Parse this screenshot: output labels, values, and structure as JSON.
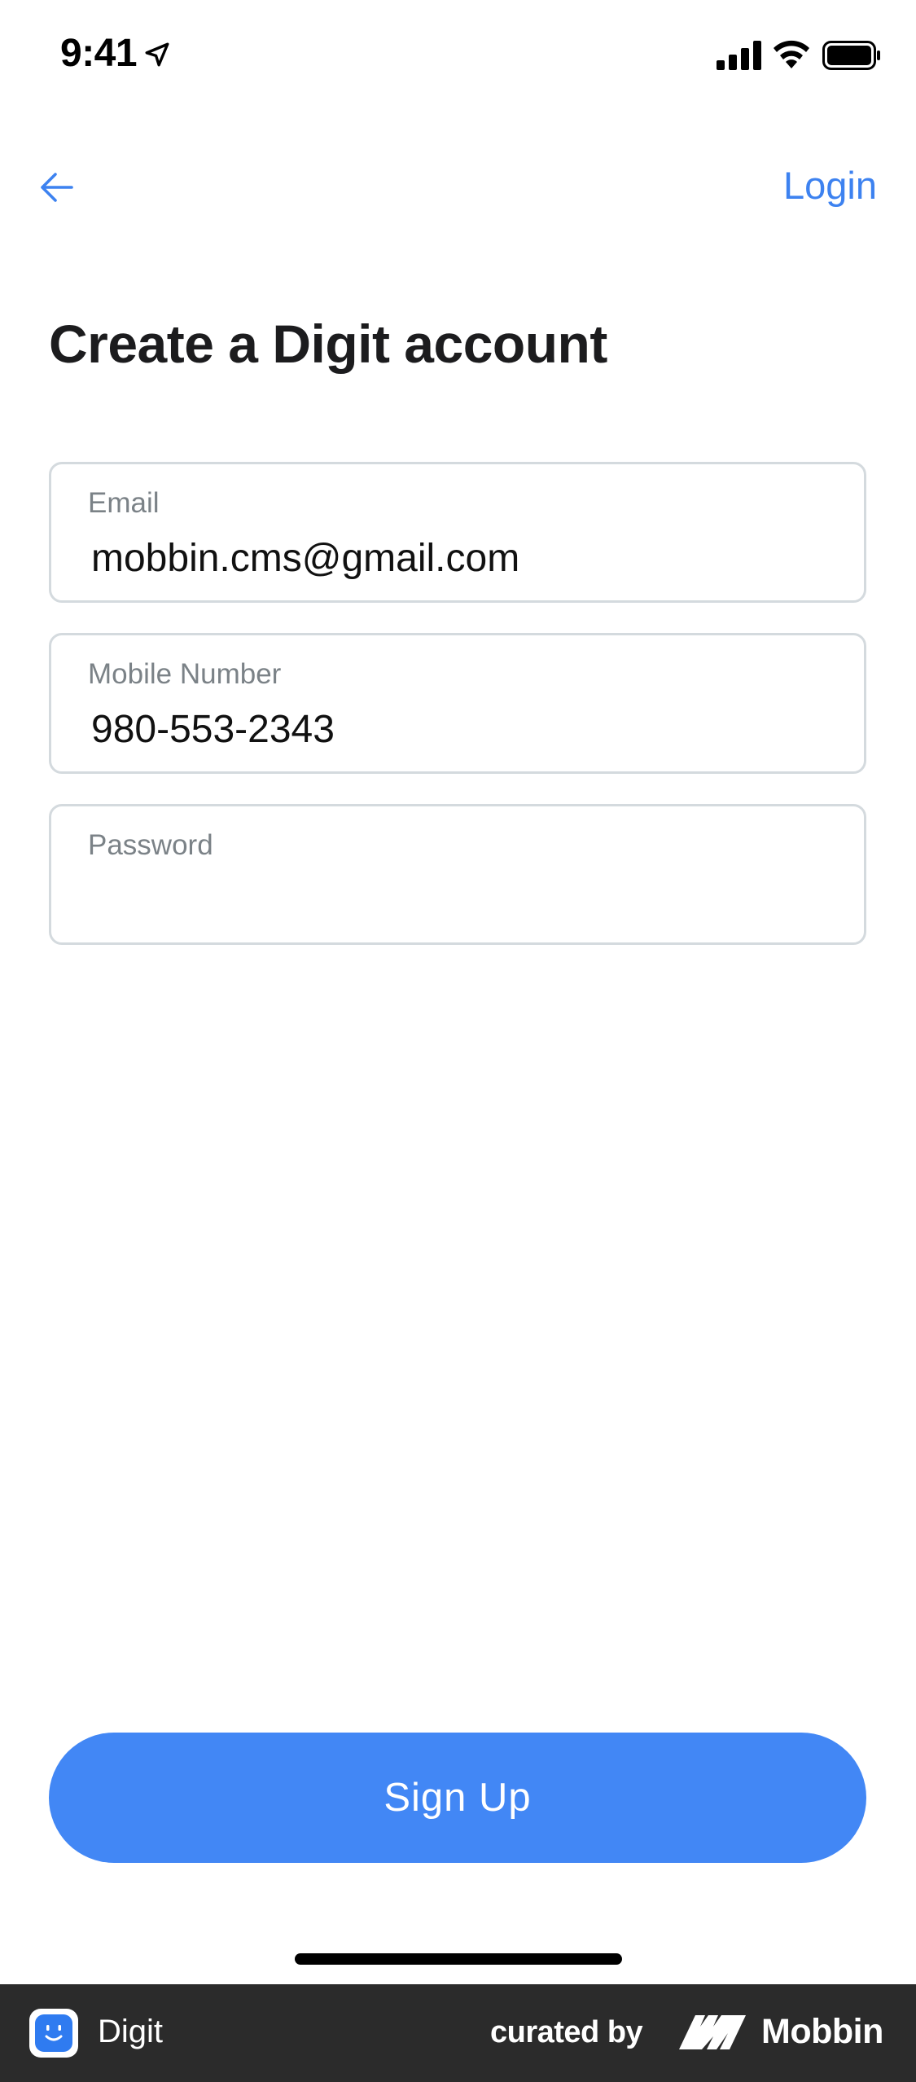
{
  "status_bar": {
    "time": "9:41"
  },
  "nav": {
    "login_label": "Login"
  },
  "page": {
    "title": "Create a Digit account"
  },
  "form": {
    "email": {
      "label": "Email",
      "value": "mobbin.cms@gmail.com"
    },
    "mobile": {
      "label": "Mobile Number",
      "value": "980-553-2343"
    },
    "password": {
      "label": "Password",
      "value": ""
    }
  },
  "actions": {
    "signup_label": "Sign Up"
  },
  "footer": {
    "app_name": "Digit",
    "curated_by": "curated by",
    "brand": "Mobbin"
  },
  "colors": {
    "accent": "#4287f5",
    "link": "#3d82f0",
    "field_border": "#d4dade",
    "footer_bg": "#2b2b2b"
  },
  "icons": [
    "location-arrow-icon",
    "cellular-signal-icon",
    "wifi-icon",
    "battery-icon",
    "back-arrow-icon",
    "digit-app-logo",
    "mobbin-logo"
  ]
}
